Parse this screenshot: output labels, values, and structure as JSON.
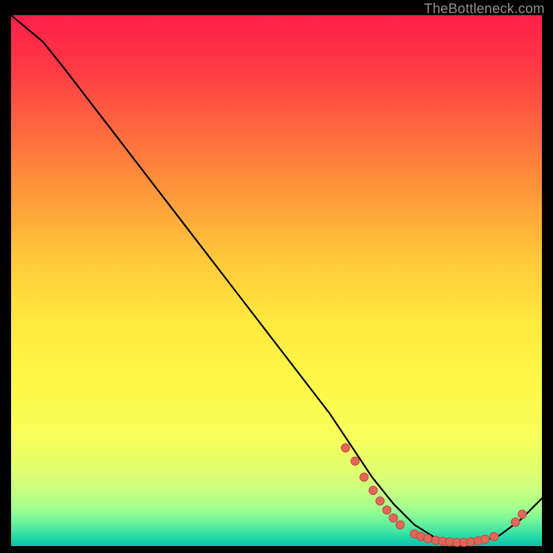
{
  "attribution": "TheBottleneck.com",
  "chart_data": {
    "type": "line",
    "title": "",
    "xlabel": "",
    "ylabel": "",
    "xlim": [
      0,
      100
    ],
    "ylim": [
      0,
      100
    ],
    "grid": false,
    "legend": false,
    "series": [
      {
        "name": "curve",
        "x": [
          0,
          6,
          10,
          20,
          30,
          40,
          50,
          60,
          64,
          68,
          72,
          76,
          80,
          84,
          88,
          92,
          96,
          100
        ],
        "values": [
          100,
          95,
          90,
          77,
          64,
          51,
          38,
          25,
          19,
          13,
          8,
          4,
          1.5,
          0.5,
          0.7,
          2.0,
          5.0,
          9.0
        ]
      }
    ],
    "annotations": [
      {
        "x": 63,
        "y": 18.5
      },
      {
        "x": 64.8,
        "y": 16.0
      },
      {
        "x": 66.5,
        "y": 13.0
      },
      {
        "x": 68.2,
        "y": 10.5
      },
      {
        "x": 69.5,
        "y": 8.5
      },
      {
        "x": 70.8,
        "y": 6.8
      },
      {
        "x": 72.0,
        "y": 5.3
      },
      {
        "x": 73.3,
        "y": 4.0
      },
      {
        "x": 76.0,
        "y": 2.3
      },
      {
        "x": 77.2,
        "y": 1.8
      },
      {
        "x": 78.5,
        "y": 1.4
      },
      {
        "x": 80.0,
        "y": 1.1
      },
      {
        "x": 81.3,
        "y": 0.9
      },
      {
        "x": 82.6,
        "y": 0.8
      },
      {
        "x": 84.0,
        "y": 0.7
      },
      {
        "x": 85.3,
        "y": 0.7
      },
      {
        "x": 86.6,
        "y": 0.8
      },
      {
        "x": 88.0,
        "y": 1.0
      },
      {
        "x": 89.3,
        "y": 1.3
      },
      {
        "x": 91.0,
        "y": 1.8
      },
      {
        "x": 95.0,
        "y": 4.5
      },
      {
        "x": 96.3,
        "y": 6.0
      }
    ]
  }
}
